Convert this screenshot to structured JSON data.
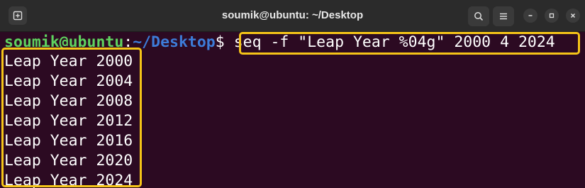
{
  "window": {
    "title": "soumik@ubuntu: ~/Desktop"
  },
  "prompt": {
    "user_host": "soumik@ubuntu",
    "separator": ":",
    "path": "~/Desktop",
    "symbol": "$"
  },
  "command": "seq -f \"Leap Year %04g\" 2000 4 2024",
  "output": [
    "Leap Year 2000",
    "Leap Year 2004",
    "Leap Year 2008",
    "Leap Year 2012",
    "Leap Year 2016",
    "Leap Year 2020",
    "Leap Year 2024"
  ],
  "colors": {
    "terminal_bg": "#2c0a22",
    "titlebar_bg": "#2b2b2b",
    "prompt_user": "#5fd35f",
    "prompt_path": "#3d7cd8",
    "highlight": "#f5c518"
  },
  "icons": [
    "new-tab-icon",
    "search-icon",
    "hamburger-menu-icon",
    "minimize-icon",
    "maximize-icon",
    "close-icon"
  ]
}
